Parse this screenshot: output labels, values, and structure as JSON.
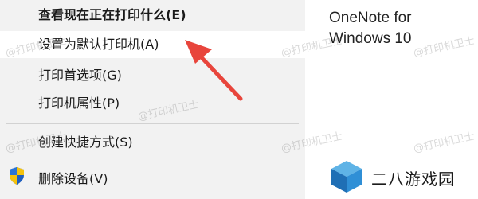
{
  "menu": {
    "items": [
      {
        "label": "查看现在正在打印什么(E)",
        "bold": true
      },
      {
        "label": "设置为默认打印机(A)",
        "highlighted": true
      },
      {
        "label": "打印首选项(G)"
      },
      {
        "label": "打印机属性(P)"
      },
      {
        "label": "创建快捷方式(S)"
      },
      {
        "label": "删除设备(V)",
        "icon": "uac-shield-icon"
      }
    ]
  },
  "right_pane": {
    "app_name_line1": "OneNote for",
    "app_name_line2": "Windows 10"
  },
  "brand": {
    "text": "二八游戏园",
    "logo": "cube-logo-icon"
  },
  "watermark": {
    "text": "@打印机卫士"
  },
  "annotation": {
    "arrow": "red-arrow-icon",
    "color": "#e8453c"
  }
}
